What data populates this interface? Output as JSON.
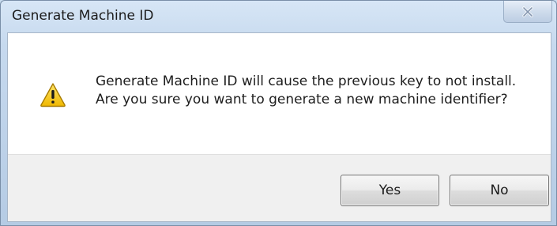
{
  "window": {
    "title": "Generate Machine ID",
    "close_icon": "close-icon"
  },
  "dialog": {
    "icon": "warning-icon",
    "message_line1": "Generate Machine ID will cause the previous key to not install.",
    "message_line2": "Are you sure you want to generate a new machine identifier?"
  },
  "buttons": {
    "yes_label": "Yes",
    "no_label": "No"
  },
  "colors": {
    "warning_fill": "#f2c31a",
    "warning_border": "#a77b00",
    "footer_bg": "#f0f0f0"
  }
}
